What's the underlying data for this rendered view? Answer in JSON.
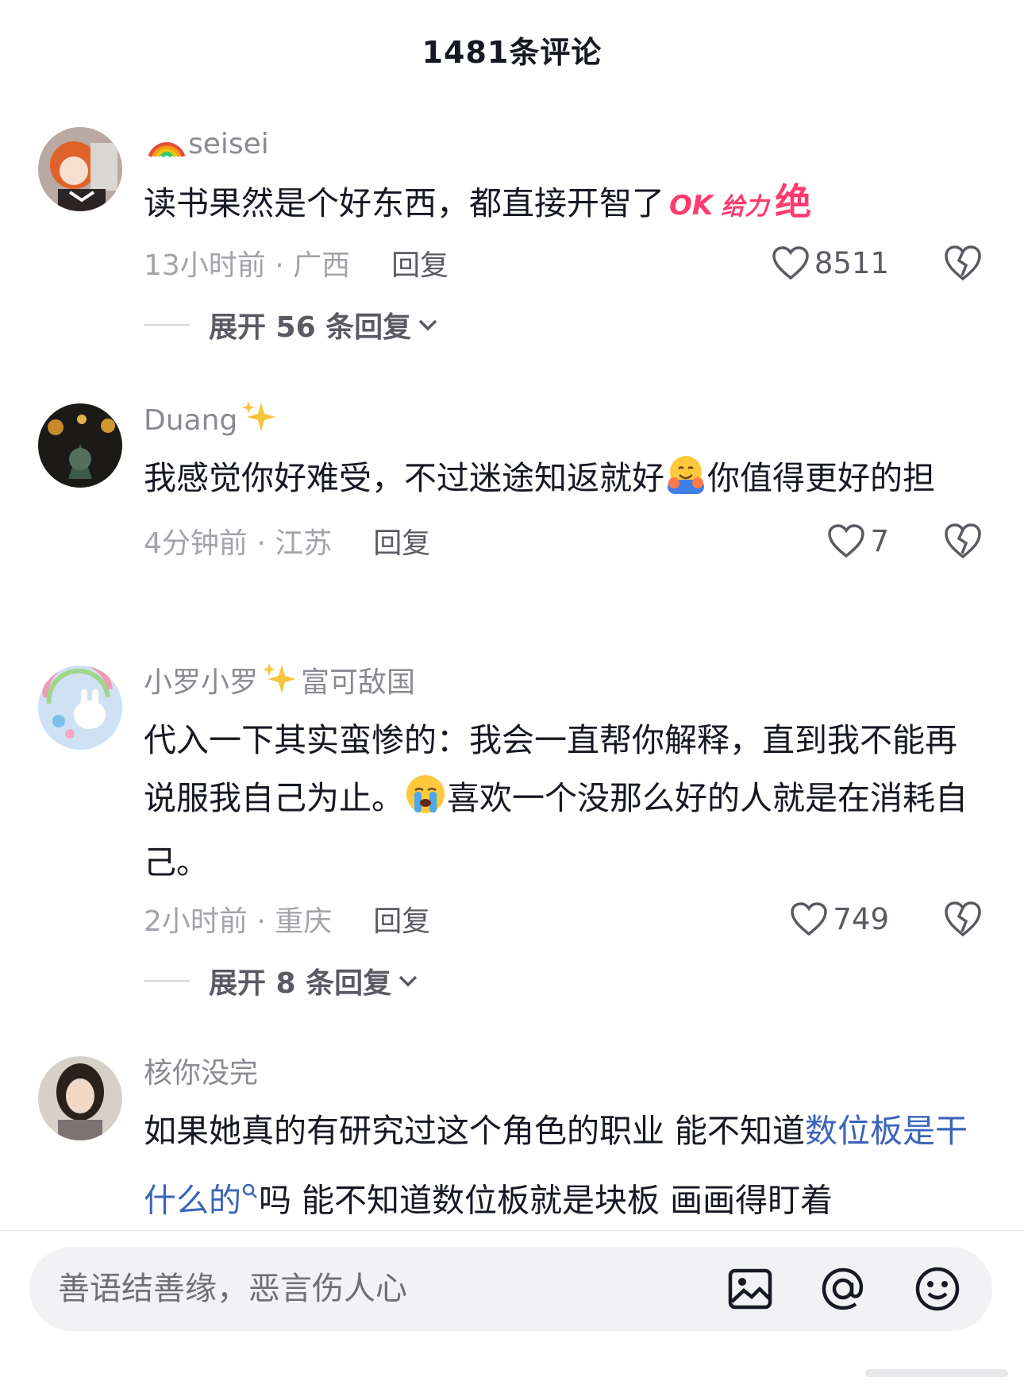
{
  "header": {
    "title": "1481条评论"
  },
  "comments": [
    {
      "username": "seisei",
      "username_prefix_icon": "rainbow-emoji",
      "text": "读书果然是个好东西，都直接开智了",
      "stickers": [
        "OK",
        "给力",
        "绝"
      ],
      "time_location": "13小时前 · 广西",
      "reply_label": "回复",
      "likes": "8511",
      "expand_label": "展开 56 条回复"
    },
    {
      "username": "Duang",
      "username_suffix_icon": "sparkles-emoji",
      "text_part1": "我感觉你好难受，不过迷途知返就好",
      "text_emoji": "hugging-face-emoji",
      "text_part2": "你值得更好的担",
      "time_location": "4分钟前 · 江苏",
      "reply_label": "回复",
      "likes": "7"
    },
    {
      "username": "小罗小罗",
      "username_suffix_icon": "sparkles-emoji",
      "username_suffix_text": "富可敌国",
      "text_part1": "代入一下其实蛮惨的：我会一直帮你解释，直到我不能再说服我自己为止。",
      "text_emoji": "loudly-crying-face-emoji",
      "text_part2": "喜欢一个没那么好的人就是在消耗自己。",
      "time_location": "2小时前 · 重庆",
      "reply_label": "回复",
      "likes": "749",
      "expand_label": "展开 8 条回复"
    },
    {
      "username": "核你没完",
      "text_part1": "如果她真的有研究过这个角色的职业 能不知道",
      "link_text": "数位板是干什么的",
      "link_icon": "search-icon",
      "text_part2": "吗 能不知道数位板就是块板 画画得盯着"
    }
  ],
  "input_bar": {
    "placeholder": "善语结善缘，恶言伤人心",
    "icons": [
      "image-icon",
      "at-icon",
      "emoji-icon"
    ]
  },
  "colors": {
    "link": "#3b64b9",
    "sticker_pink": "#ff3b6f",
    "meta_gray": "#a3a4aa"
  }
}
